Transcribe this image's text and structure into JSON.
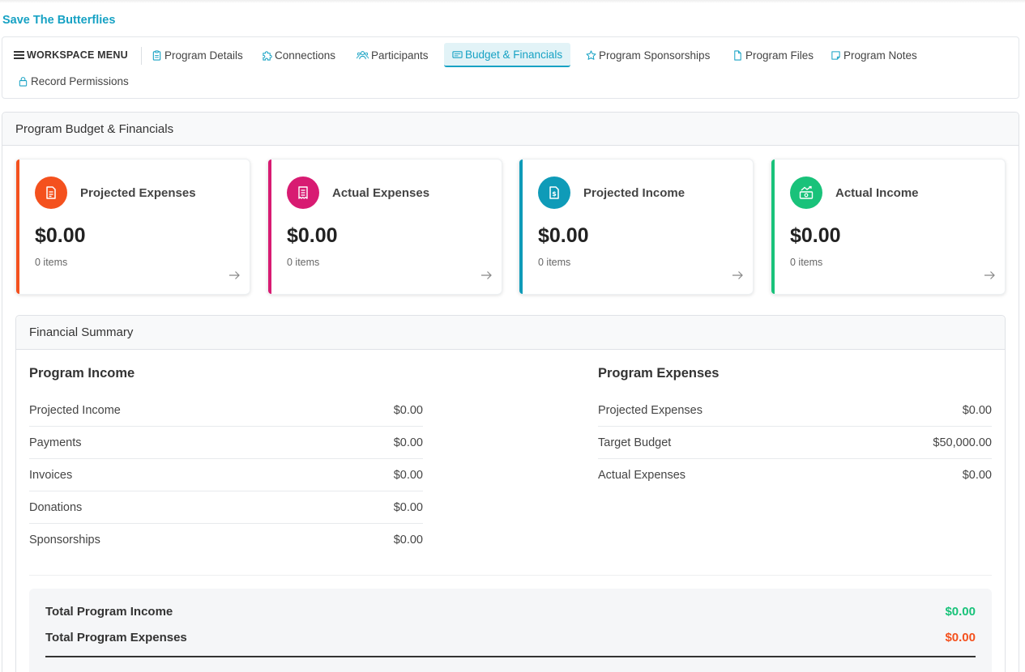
{
  "app": {
    "title": "Save The Butterflies"
  },
  "nav": {
    "menu_label": "WORKSPACE MENU",
    "items": [
      {
        "label": "Program Details",
        "icon": "clipboard-icon"
      },
      {
        "label": "Connections",
        "icon": "puzzle-icon"
      },
      {
        "label": "Participants",
        "icon": "users-icon"
      },
      {
        "label": "Budget & Financials",
        "icon": "receipt-icon",
        "active": true
      },
      {
        "label": "Program Sponsorships",
        "icon": "star-icon"
      },
      {
        "label": "Program Files",
        "icon": "file-icon"
      },
      {
        "label": "Program Notes",
        "icon": "note-icon"
      },
      {
        "label": "Record Permissions",
        "icon": "lock-icon"
      }
    ]
  },
  "panel": {
    "title": "Program Budget & Financials"
  },
  "cards": [
    {
      "title": "Projected Expenses",
      "value": "$0.00",
      "count": "0 items",
      "color": "#f4511e",
      "icon": "invoice-icon"
    },
    {
      "title": "Actual Expenses",
      "value": "$0.00",
      "count": "0 items",
      "color": "#d81b72",
      "icon": "receipt-icon"
    },
    {
      "title": "Projected Income",
      "value": "$0.00",
      "count": "0 items",
      "color": "#0f9bb8",
      "icon": "dollar-file-icon"
    },
    {
      "title": "Actual Income",
      "value": "$0.00",
      "count": "0 items",
      "color": "#19c27a",
      "icon": "money-growth-icon"
    }
  ],
  "summary": {
    "title": "Financial Summary",
    "income": {
      "heading": "Program Income",
      "rows": [
        {
          "label": "Projected Income",
          "value": "$0.00"
        },
        {
          "label": "Payments",
          "value": "$0.00"
        },
        {
          "label": "Invoices",
          "value": "$0.00"
        },
        {
          "label": "Donations",
          "value": "$0.00"
        },
        {
          "label": "Sponsorships",
          "value": "$0.00"
        }
      ]
    },
    "expenses": {
      "heading": "Program Expenses",
      "rows": [
        {
          "label": "Projected Expenses",
          "value": "$0.00"
        },
        {
          "label": "Target Budget",
          "value": "$50,000.00"
        },
        {
          "label": "Actual Expenses",
          "value": "$0.00"
        }
      ]
    },
    "totals": {
      "income_label": "Total Program Income",
      "income_value": "$0.00",
      "income_color": "#19c27a",
      "expenses_label": "Total Program Expenses",
      "expenses_value": "$0.00",
      "expenses_color": "#f4511e"
    }
  },
  "colors": {
    "accent": "#17a2c4"
  }
}
